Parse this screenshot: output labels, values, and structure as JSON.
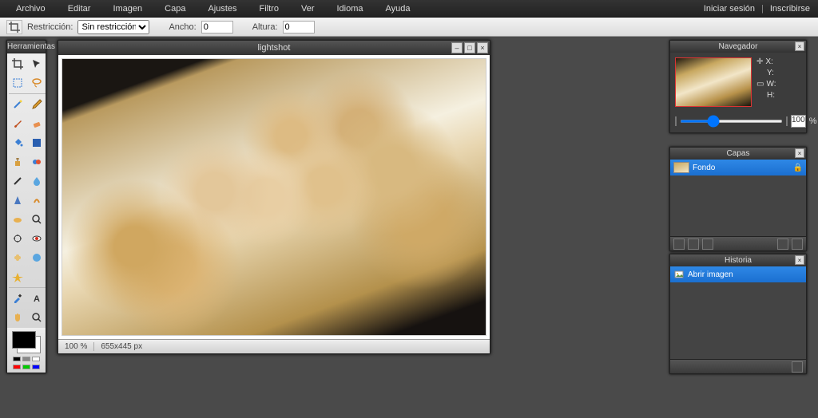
{
  "menubar": {
    "items": [
      "Archivo",
      "Editar",
      "Imagen",
      "Capa",
      "Ajustes",
      "Filtro",
      "Ver",
      "Idioma",
      "Ayuda"
    ],
    "login": "Iniciar sesión",
    "signup": "Inscribirse"
  },
  "options": {
    "restrict_label": "Restricción:",
    "restrict_value": "Sin restricción",
    "width_label": "Ancho:",
    "width_value": "0",
    "height_label": "Altura:",
    "height_value": "0"
  },
  "toolbox": {
    "title": "Herramientas"
  },
  "canvas": {
    "title": "lightshot",
    "zoom": "100 %",
    "dims": "655x445 px"
  },
  "navigator": {
    "title": "Navegador",
    "x_label": "X:",
    "y_label": "Y:",
    "w_label": "W:",
    "h_label": "H:",
    "zoom_value": "100",
    "zoom_unit": "%"
  },
  "layers": {
    "title": "Capas",
    "items": [
      {
        "name": "Fondo"
      }
    ]
  },
  "history": {
    "title": "Historia",
    "items": [
      {
        "label": "Abrir imagen"
      }
    ]
  }
}
